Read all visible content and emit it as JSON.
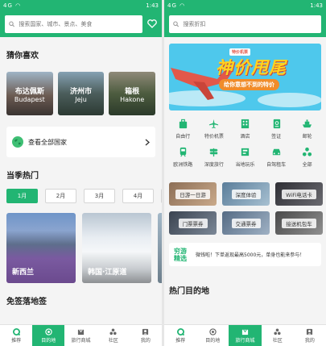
{
  "status": {
    "time": "1:43",
    "carrier": "4G ◠"
  },
  "left": {
    "search_placeholder": "搜索国家、城市、景点、美食",
    "guess_title": "猜你喜欢",
    "cities": [
      {
        "cn": "布达佩斯",
        "en": "Budapest"
      },
      {
        "cn": "济州市",
        "en": "Jeju"
      },
      {
        "cn": "箱根",
        "en": "Hakone"
      }
    ],
    "view_all": "查看全部国家",
    "season_title": "当季热门",
    "months": [
      "1月",
      "2月",
      "3月",
      "4月",
      "5"
    ],
    "destinations": [
      "新西兰",
      "韩国·江原道"
    ],
    "visa_title": "免签落地签"
  },
  "right": {
    "search_placeholder": "搜索折扣",
    "banner_title": "神价甩尾",
    "banner_sub": "给你意想不到的特价",
    "banner_tag": "特价机票",
    "icons": [
      "自由行",
      "特价机票",
      "酒店",
      "签证",
      "邮轮",
      "欧洲铁路",
      "深度旅行",
      "当地玩乐",
      "自驾租车",
      "全部"
    ],
    "tiles": [
      "日游一日游",
      "深度体验",
      "WiFi电话卡",
      "门票票券",
      "交通票券",
      "接送机包车"
    ],
    "promo_logo": "穷游精选",
    "promo_text": "微钱啦！下单返现最高5000元，单身也能来参与！",
    "hot_title": "热门目的地"
  },
  "tabs": {
    "left": [
      "推荐",
      "目的地",
      "旅行商城",
      "社区",
      "我的"
    ],
    "right": [
      "推荐",
      "目的地",
      "旅行商城",
      "社区",
      "我的"
    ]
  }
}
